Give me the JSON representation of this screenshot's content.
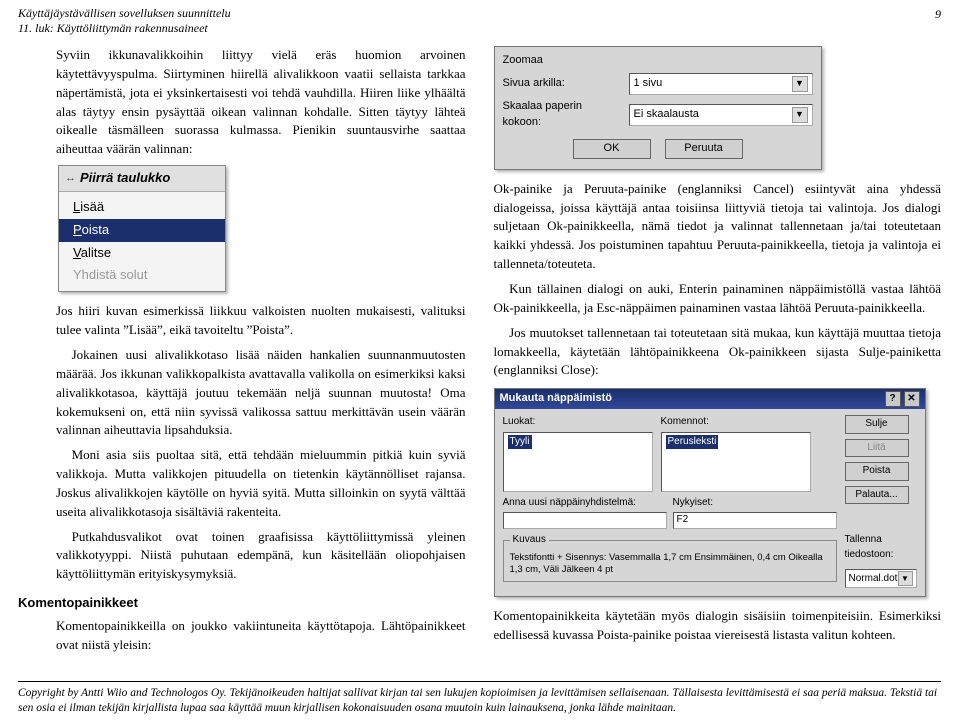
{
  "header": {
    "line1": "Käyttäjäystävällisen sovelluksen suunnittelu",
    "line2": "11. luk: Käyttöliittymän rakennusaineet",
    "page_number": "9"
  },
  "col1": {
    "p1": "Syviin ikkunavalikkoihin liittyy vielä eräs huomion arvoinen käytettävyyspulma. Siirtyminen hiirellä alivalikkoon vaatii sellaista tarkkaa näpertämistä, jota ei yksinkertaisesti voi tehdä vauhdilla. Hiiren liike ylhäältä alas täytyy ensin pysäyttää oikean valinnan kohdalle. Sitten täytyy lähteä oikealle täsmälleen suorassa kulmassa. Pienikin suuntausvirhe saattaa aiheuttaa väärän valinnan:",
    "menu": {
      "title": "Piirrä taulukko",
      "items": [
        "Lisää",
        "Poista",
        "Valitse",
        "Yhdistä solut"
      ],
      "selected_index": 1,
      "disabled_index": 3
    },
    "p2": "Jos hiiri kuvan esimerkissä liikkuu valkoisten nuolten mukaisesti, valituksi tulee valinta ”Lisää”, eikä tavoiteltu ”Poista”.",
    "p3": "Jokainen uusi alivalikkotaso lisää näiden hankalien suunnanmuutosten määrää. Jos ikkunan valikkopalkista avattavalla valikolla on esimerkiksi kaksi alivalikkotasoa, käyttäjä joutuu tekemään neljä suunnan muutosta! Oma kokemukseni on, että niin syvissä valikossa sattuu merkittävän usein väärän valinnan aiheuttavia lipsahduksia.",
    "p4": "Moni asia siis puoltaa sitä, että tehdään mieluummin pitkiä kuin syviä valikkoja. Mutta valikkojen pituudella on tietenkin käytännölliset rajansa. Joskus alivalikkojen käytölle on hyviä syitä. Mutta silloinkin on syytä välttää useita alivalikkotasoja sisältäviä rakenteita.",
    "p5": "Putkahdusvalikot ovat toinen graafisissa käyttöliittymissä yleinen valikkotyyppi. Niistä puhutaan edempänä, kun käsitellään oliopohjaisen käyttöliittymän erityiskysymyksiä.",
    "h_komento": "Komentopainikkeet",
    "p6": "Komentopainikkeilla on joukko vakiintuneita käyttötapoja. Lähtöpainikkeet ovat niistä yleisin:"
  },
  "col2": {
    "zoom_dialog": {
      "title": "Zoomaa",
      "row1_label": "Sivua arkilla:",
      "row1_value": "1 sivu",
      "row2_label": "Skaalaa paperin kokoon:",
      "row2_value": "Ei skaalausta",
      "ok": "OK",
      "cancel": "Peruuta"
    },
    "p1": "Ok-painike ja Peruuta-painike (englanniksi Cancel) esiintyvät aina yhdessä dialogeissa, joissa käyttäjä antaa toisiinsa liittyviä tietoja tai valintoja. Jos dialogi suljetaan Ok-painikkeella, nämä tiedot ja valinnat tallennetaan ja/tai toteutetaan kaikki yhdessä. Jos poistuminen tapahtuu Peruuta-painikkeella, tietoja ja valintoja ei tallenneta/toteuteta.",
    "p2": "Kun tällainen dialogi on auki, Enterin painaminen näppäimistöllä vastaa lähtöä Ok-painikkeella, ja Esc-näppäimen painaminen vastaa lähtöä Peruuta-painikkeella.",
    "p3": "Jos muutokset tallennetaan tai toteutetaan sitä mukaa, kun käyttäjä muuttaa tietoja lomakkeella, käytetään lähtöpainikkeena Ok-painikkeen sijasta Sulje-painiketta (englanniksi Close):",
    "kbd_dialog": {
      "title": "Mukauta näppäimistö",
      "luokat_label": "Luokat:",
      "komennot_label": "Komennot:",
      "luokat_items": [
        "Tyyli"
      ],
      "komennot_items": [
        "Perusleksti"
      ],
      "assign_label": "Anna uusi näppäinyhdistelmä:",
      "current_label": "Nykyiset:",
      "current_value": "F2",
      "kuvaus_title": "Kuvaus",
      "kuvaus_text": "Tekstifontti + Sisennys: Vasemmalla  1,7 cm Ensimmäinen, 0,4 cm Oikealla  1,3 cm, Väli Jälkeen 4 pt",
      "save_label": "Tallenna tiedostoon:",
      "save_value": "Normal.dot",
      "btn_sulje": "Sulje",
      "btn_liita": "Liitä",
      "btn_poista": "Poista",
      "btn_palauta": "Palauta..."
    },
    "p4": "Komentopainikkeita käytetään myös dialogin sisäisiin toimenpiteisiin. Esimerkiksi edellisessä kuvassa Poista-painike poistaa viereisestä listasta valitun kohteen."
  },
  "footer": {
    "text": "Copyright by Antti Wiio and Technologos Oy. Tekijänoikeuden haltijat sallivat kirjan tai sen lukujen kopioimisen ja levittämisen sellaisenaan. Tällaisesta levittämisestä ei saa periä maksua. Tekstiä tai sen osia ei ilman tekijän kirjallista lupaa saa käyttää muun kirjallisen kokonaisuuden osana muutoin kuin lainauksena, jonka lähde mainitaan."
  }
}
